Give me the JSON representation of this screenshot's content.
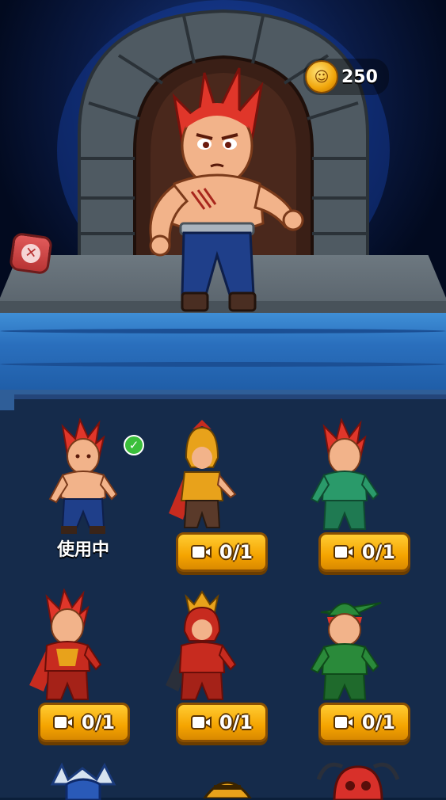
{
  "header": {
    "coin_count": "250"
  },
  "characters": [
    {
      "status": "使用中",
      "selected": true,
      "type": "shirtless-hero"
    },
    {
      "ad_progress": "0/1",
      "type": "spartan-gold"
    },
    {
      "ad_progress": "0/1",
      "type": "green-armor"
    },
    {
      "ad_progress": "0/1",
      "type": "red-armor-cape"
    },
    {
      "ad_progress": "0/1",
      "type": "samurai"
    },
    {
      "ad_progress": "0/1",
      "type": "robin-hood"
    }
  ],
  "colors": {
    "button": "#f5a400",
    "panel": "#152b4b",
    "accent": "#2f5e98"
  }
}
